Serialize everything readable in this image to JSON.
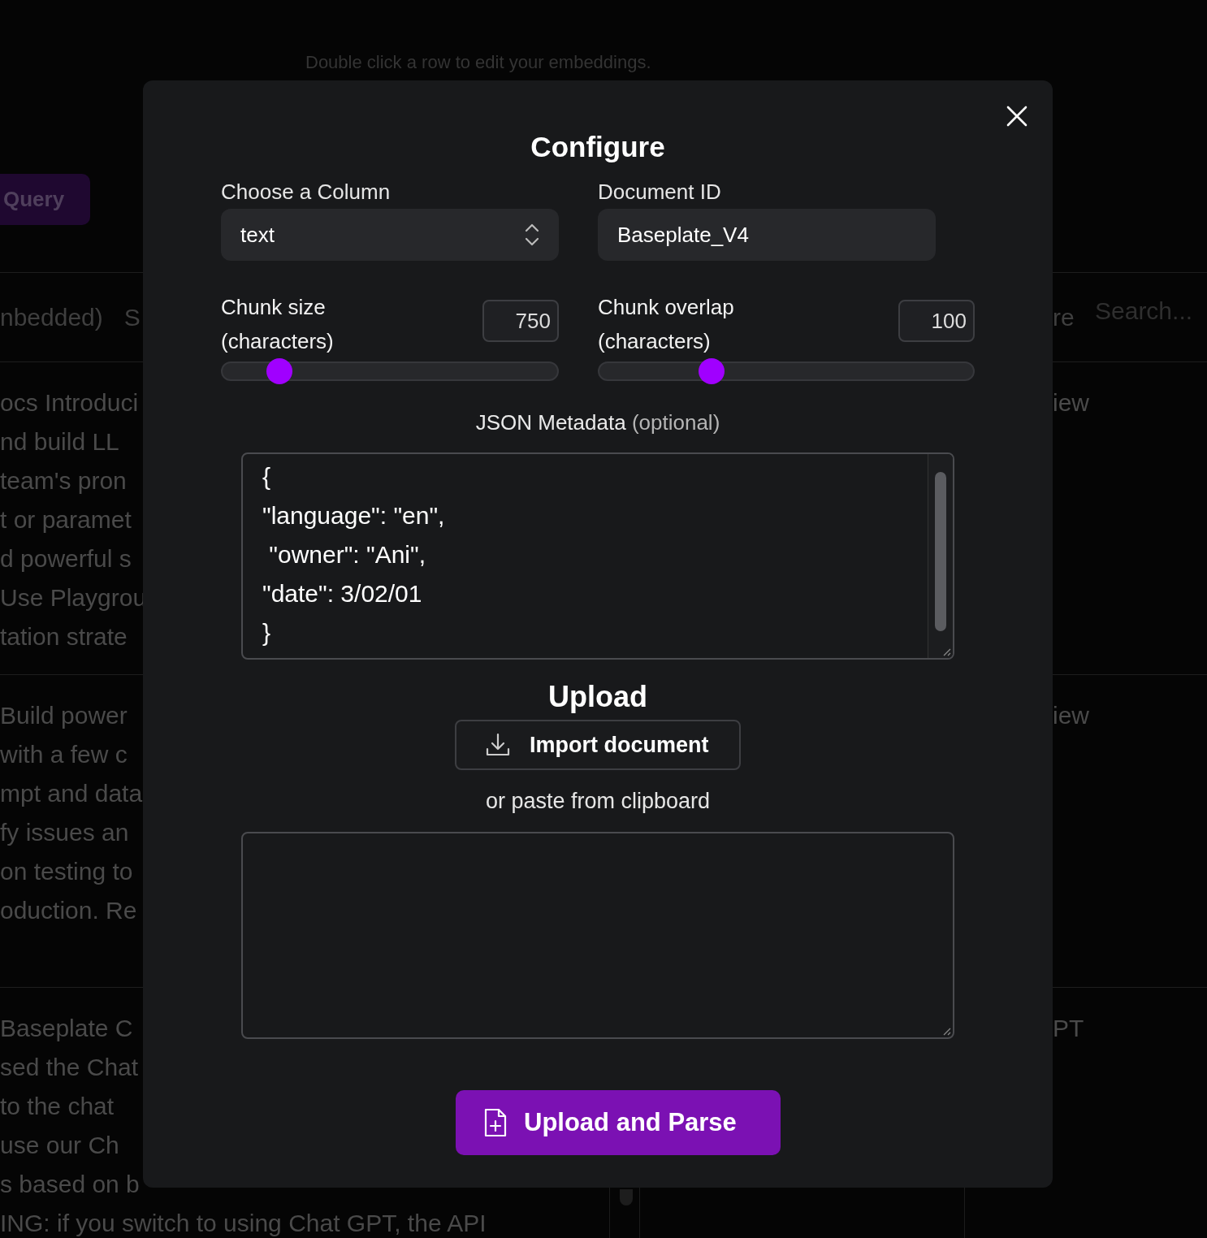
{
  "background": {
    "hint": "Double click a row to edit your embeddings.",
    "query_button": "Query",
    "header": {
      "column_1": "nbedded)",
      "column_2": "S",
      "column_3": "re",
      "search": {
        "placeholder": "Search..."
      }
    },
    "rows": [
      {
        "lines": [
          "ocs Introduci",
          "nd build LL",
          "team's pron",
          "t or paramet",
          "d powerful s",
          "Use Playgrou",
          "tation strate"
        ],
        "column_4": "iew"
      },
      {
        "lines": [
          "Build power",
          "with a few c",
          "mpt and data",
          "fy issues an",
          "on testing to",
          "oduction. Re"
        ],
        "column_4": "iew"
      },
      {
        "lines": [
          "Baseplate C",
          "sed the Chat",
          "to the chat",
          "use our Ch",
          "s based on b",
          "ING: if you switch to using Chat GPT, the API"
        ],
        "column_4": "PT"
      }
    ]
  },
  "dialog": {
    "title": "Configure",
    "column_select": {
      "label": "Choose a Column",
      "value": "text"
    },
    "document_id": {
      "label": "Document ID",
      "value": "Baseplate_V4"
    },
    "sliders": [
      {
        "label": "Chunk size (characters)",
        "reading": "750",
        "level": 0.17
      },
      {
        "label": "Chunk overlap (characters)",
        "reading": "100",
        "level": 0.3
      }
    ],
    "metadata": {
      "label": "JSON Metadata",
      "hint": "(optional)",
      "value": "{\n\"language\": \"en\",\n \"owner\": \"Ani\",\n\"date\": 3/02/01\n}"
    },
    "upload": {
      "title": "Upload",
      "import_button": "Import document",
      "paste_hint": "or paste from clipboard",
      "submit_button": "Upload and Parse"
    }
  }
}
